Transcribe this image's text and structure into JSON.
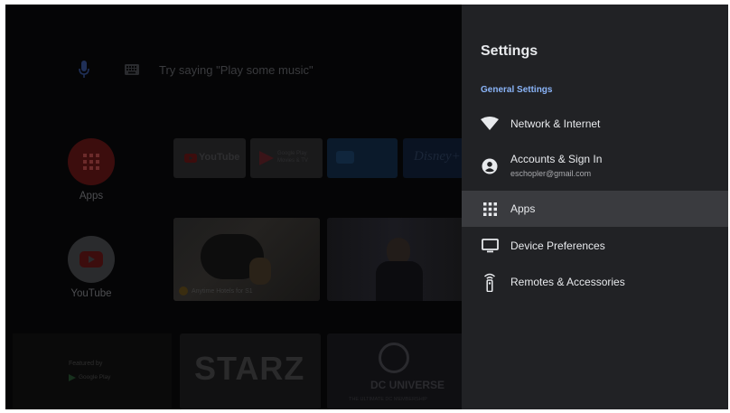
{
  "home": {
    "search": {
      "hint": "Try saying \"Play some music\""
    },
    "favorites": [
      {
        "label": "Apps"
      },
      {
        "label": "YouTube"
      }
    ],
    "channel_tiles": {
      "youtube": "YouTube",
      "play_movies": "Google Play Movies & TV",
      "disney": "Disney+"
    },
    "media_tiles": {
      "video_caption": "Anytime Hotels for S1",
      "starz": "STARZ",
      "dc_universe": "DC UNIVERSE",
      "dc_tagline": "THE ULTIMATE DC MEMBERSHIP",
      "featured_by": "Featured by",
      "google_play": "Google Play"
    }
  },
  "settings": {
    "title": "Settings",
    "section_header": "General Settings",
    "items": [
      {
        "label": "Network & Internet",
        "icon": "wifi-icon"
      },
      {
        "label": "Accounts & Sign In",
        "sublabel": "eschopler@gmail.com",
        "icon": "account-icon"
      },
      {
        "label": "Apps",
        "icon": "apps-grid-icon",
        "selected": true
      },
      {
        "label": "Device Preferences",
        "icon": "monitor-icon"
      },
      {
        "label": "Remotes & Accessories",
        "icon": "remote-icon"
      }
    ]
  },
  "colors": {
    "panel_bg": "#212225",
    "selected_bg": "#3a3b3f",
    "section_accent": "#8ab4f8",
    "text_primary": "#e8eaed"
  }
}
